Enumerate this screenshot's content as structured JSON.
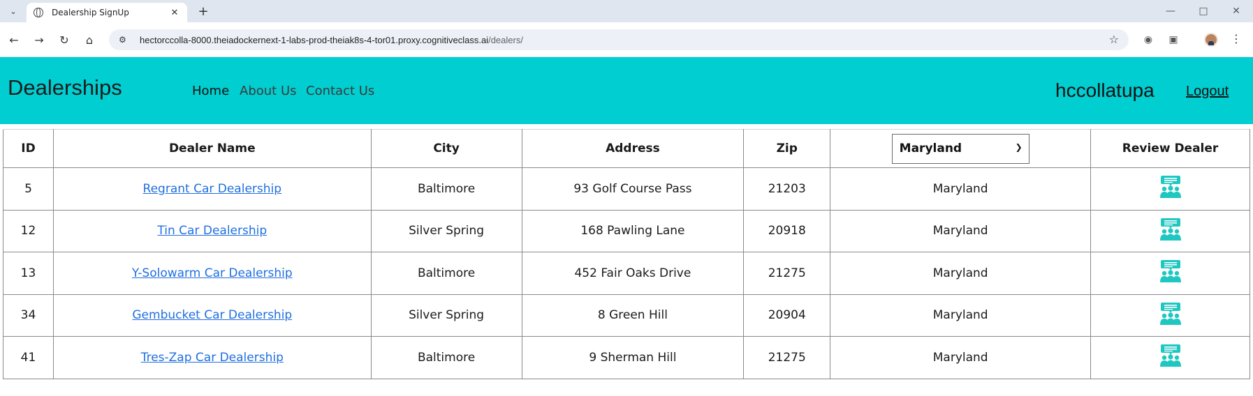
{
  "browser": {
    "tab_title": "Dealership SignUp",
    "url_host": "hectorccolla-8000.theiadockernext-1-labs-prod-theiak8s-4-tor01.proxy.cognitiveclass.ai",
    "url_path": "/dealers/"
  },
  "header": {
    "brand": "Dealerships",
    "nav": [
      "Home",
      "About Us",
      "Contact Us"
    ],
    "username": "hccollatupa",
    "logout": "Logout"
  },
  "table": {
    "columns": [
      "ID",
      "Dealer Name",
      "City",
      "Address",
      "Zip",
      "Review Dealer"
    ],
    "state_filter": "Maryland",
    "rows": [
      {
        "id": "5",
        "name": "Regrant Car Dealership",
        "city": "Baltimore",
        "address": "93 Golf Course Pass",
        "zip": "21203",
        "state": "Maryland"
      },
      {
        "id": "12",
        "name": "Tin Car Dealership",
        "city": "Silver Spring",
        "address": "168 Pawling Lane",
        "zip": "20918",
        "state": "Maryland"
      },
      {
        "id": "13",
        "name": "Y-Solowarm Car Dealership",
        "city": "Baltimore",
        "address": "452 Fair Oaks Drive",
        "zip": "21275",
        "state": "Maryland"
      },
      {
        "id": "34",
        "name": "Gembucket Car Dealership",
        "city": "Silver Spring",
        "address": "8 Green Hill",
        "zip": "20904",
        "state": "Maryland"
      },
      {
        "id": "41",
        "name": "Tres-Zap Car Dealership",
        "city": "Baltimore",
        "address": "9 Sherman Hill",
        "zip": "21275",
        "state": "Maryland"
      }
    ]
  },
  "colors": {
    "header_bg": "#00ced1",
    "link": "#1f6fe0",
    "review_icon": "#1fc7c1"
  },
  "icons": {
    "review": "review-dealer-icon"
  }
}
